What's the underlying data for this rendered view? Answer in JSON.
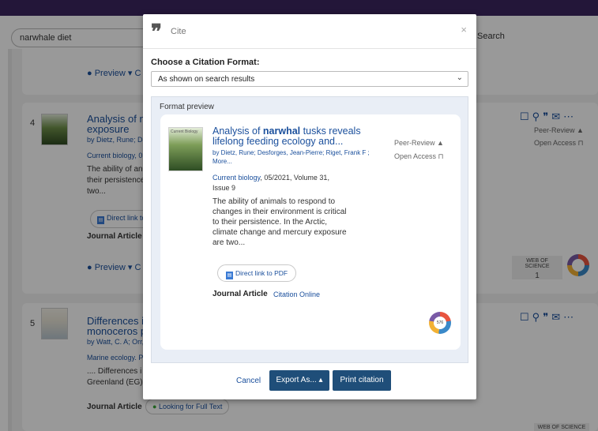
{
  "search": {
    "query": "narwhale diet",
    "button_label": "Search"
  },
  "results": [
    {
      "number": "",
      "preview_label": "Preview",
      "cite_label": "C"
    },
    {
      "number": "4",
      "title_line1": "Analysis of na",
      "title_line2": "exposure",
      "authors": "by Dietz, Rune; De",
      "journal": "Current biology, 0",
      "text_lines": [
        "The ability of an",
        "their persistence",
        "two..."
      ],
      "pdf_label": "Direct link to",
      "type": "Journal Article",
      "preview_label": "Preview",
      "cite_label": "C",
      "peer_review": "Peer-Review",
      "open_access": "Open Access",
      "wos_label": "WEB OF SCIENCE",
      "wos_count": "1",
      "thumb_label": "Current Biology"
    },
    {
      "number": "5",
      "title_line1": "Differences in",
      "title_line2": "monoceros po",
      "authors": "by Watt, C. A; Orr, J",
      "journal": "Marine ecology. P",
      "text_lines": [
        ".... Differences i",
        "Greenland (EG)"
      ],
      "type": "Journal Article",
      "full_text": "Looking for Full Text",
      "wos_label": "WEB OF SCIENCE",
      "thumb_label": "MARINE ECOLOGY"
    }
  ],
  "modal": {
    "title": "Cite",
    "close": "×",
    "choose_label": "Choose a Citation Format:",
    "format_selected": "As shown on search results",
    "preview_heading": "Format preview",
    "preview": {
      "thumb_label": "Current Biology",
      "title_prefix": "Analysis of ",
      "title_bold": "narwhal",
      "title_rest": " tusks reveals lifelong feeding ecology and...",
      "authors": "by Dietz, Rune; Desforges, Jean-Pierre; Riget, Frank F ;",
      "more": "More...",
      "journal_link": "Current biology",
      "journal_rest": ", 05/2021, Volume 31, Issue 9",
      "abstract": "The ability of animals to respond to changes in their environment is critical to their persistence. In the Arctic, climate change and mercury exposure are two...",
      "pdf_label": "Direct link to PDF",
      "type": "Journal Article",
      "citation_online": "Citation Online",
      "peer_review": "Peer-Review",
      "open_access": "Open Access",
      "altmetric_score": "576"
    },
    "footer": {
      "cancel": "Cancel",
      "export": "Export As...",
      "print": "Print citation"
    }
  },
  "colors": {
    "topbar": "#3b2660",
    "link": "#1a4f9c",
    "primary_button": "#1f4e79"
  }
}
